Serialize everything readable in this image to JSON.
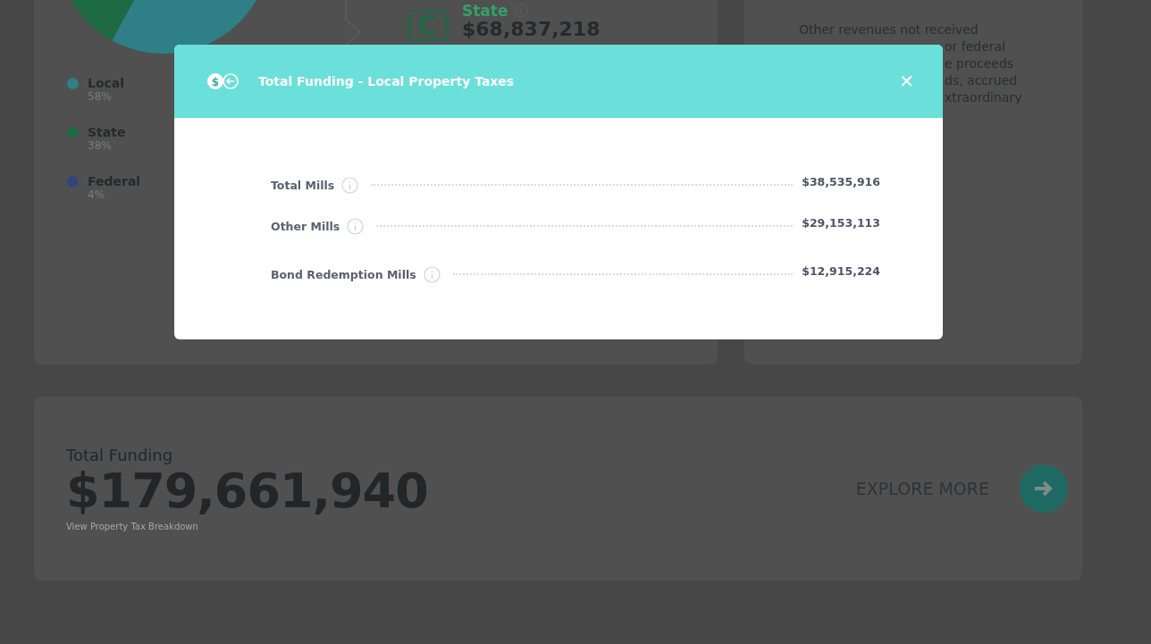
{
  "funding_card": {
    "legend": [
      {
        "label": "Local",
        "percent": "58%",
        "color": "#2f7f86"
      },
      {
        "label": "State",
        "percent": "38%",
        "color": "#1d6a43"
      },
      {
        "label": "Federal",
        "percent": "4%",
        "color": "#34457a"
      }
    ],
    "source": {
      "label": "State",
      "amount": "$68,837,218"
    }
  },
  "other_card": {
    "lines": [
      "Other revenues not received",
      "or federal",
      "e proceeds",
      "ds, accrued",
      "xtraordinary"
    ]
  },
  "total_card": {
    "title": "Total Funding",
    "amount": "$179,661,940",
    "link": "View Property Tax Breakdown",
    "explore": "EXPLORE MORE"
  },
  "modal": {
    "icon_label": "$",
    "title": "Total Funding - Local Property Taxes",
    "close": "✕",
    "rows": [
      {
        "label": "Total Mills",
        "value": "$38,535,916"
      },
      {
        "label": "Other Mills",
        "value": "$29,153,113"
      },
      {
        "label": "Bond Redemption Mills",
        "value": "$12,915,224"
      }
    ]
  }
}
